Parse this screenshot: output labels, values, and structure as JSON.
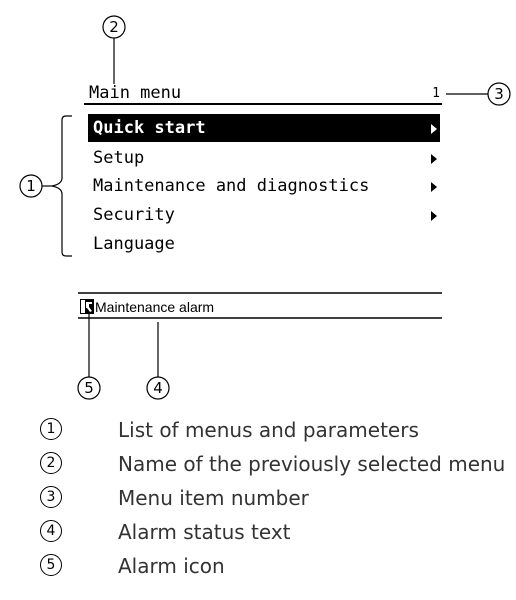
{
  "screen": {
    "title": "Main menu",
    "item_number": "1",
    "menu_items": [
      {
        "label": "Quick start",
        "has_submenu": true,
        "selected": true
      },
      {
        "label": "Setup",
        "has_submenu": true,
        "selected": false
      },
      {
        "label": "Maintenance and diagnostics",
        "has_submenu": true,
        "selected": false
      },
      {
        "label": "Security",
        "has_submenu": true,
        "selected": false
      },
      {
        "label": "Language",
        "has_submenu": false,
        "selected": false
      }
    ],
    "status_text": "Maintenance alarm",
    "alarm_icon": "maintenance-alarm-icon"
  },
  "callouts": [
    "1",
    "2",
    "3",
    "4",
    "5"
  ],
  "legend": [
    {
      "number": "1",
      "text": "List of menus and parameters"
    },
    {
      "number": "2",
      "text": "Name of the previously selected menu"
    },
    {
      "number": "3",
      "text": "Menu item number"
    },
    {
      "number": "4",
      "text": "Alarm status text"
    },
    {
      "number": "5",
      "text": "Alarm icon"
    }
  ]
}
